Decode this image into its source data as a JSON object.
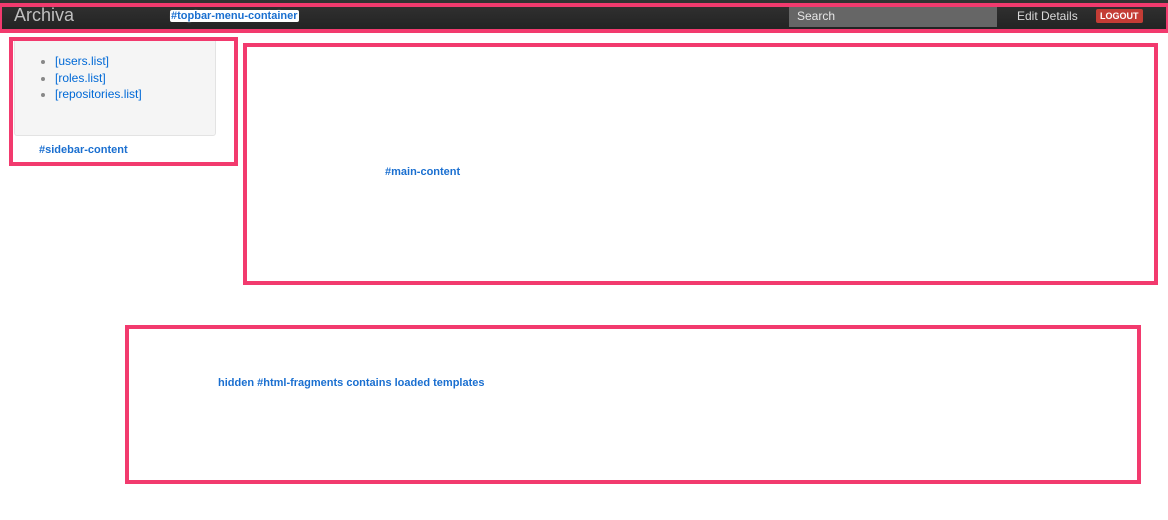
{
  "topbar": {
    "brand": "Archiva",
    "search_placeholder": "Search",
    "edit_details": "Edit Details",
    "logout": "LOGOUT"
  },
  "sidebar": {
    "items": [
      {
        "label": "[users.list]"
      },
      {
        "label": "[roles.list]"
      },
      {
        "label": "[repositories.list]"
      }
    ]
  },
  "annotations": {
    "topbar_label": "#topbar-menu-container",
    "sidebar_label": "#sidebar-content",
    "main_label": "#main-content",
    "hidden_label": "hidden #html-fragments contains loaded templates"
  },
  "colors": {
    "highlight": "#f23a6e",
    "label": "#1a6fd0",
    "logout": "#c43c35",
    "topbar": "#222222"
  }
}
